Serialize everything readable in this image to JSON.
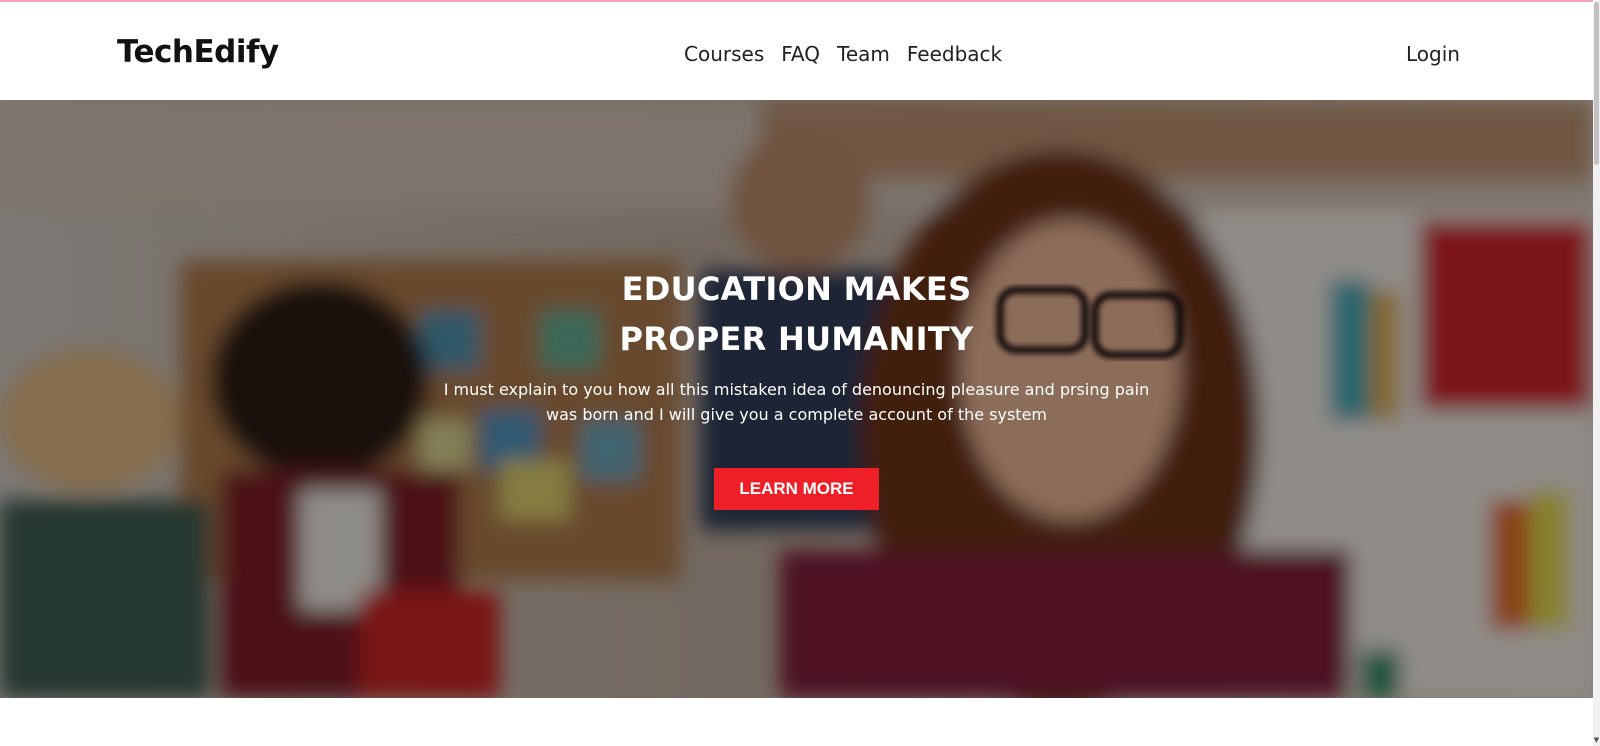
{
  "brand": {
    "name": "TechEdify"
  },
  "nav": {
    "items": [
      {
        "label": "Courses"
      },
      {
        "label": "FAQ"
      },
      {
        "label": "Team"
      },
      {
        "label": "Feedback"
      }
    ],
    "login_label": "Login"
  },
  "hero": {
    "title_line1": "EDUCATION MAKES",
    "title_line2": "PROPER HUMANITY",
    "text_line1": "I must explain to you how all this mistaken idea of denouncing pleasure and prsing pain",
    "text_line2": "was born and I will give you a complete account of the system",
    "button_label": "LEARN MORE",
    "button_color": "#ee1f27"
  },
  "scrollbar": {
    "arrow_icon": "chevron-down-icon"
  }
}
